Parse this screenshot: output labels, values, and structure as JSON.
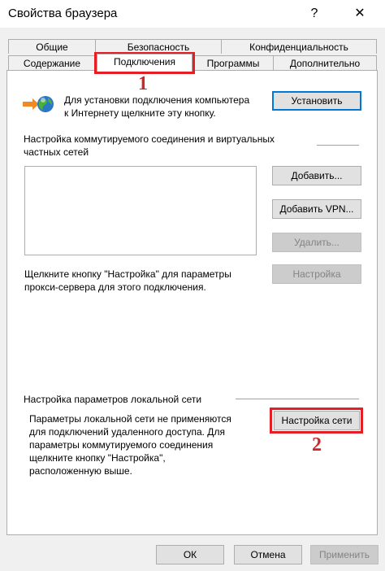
{
  "window": {
    "title": "Свойства браузера",
    "help_label": "?",
    "close_label": "✕"
  },
  "tabs": {
    "row1": [
      "Общие",
      "Безопасность",
      "Конфиденциальность"
    ],
    "row2": [
      "Содержание",
      "Подключения",
      "Программы",
      "Дополнительно"
    ],
    "active": "Подключения"
  },
  "setup": {
    "text_line1": "Для установки подключения компьютера",
    "text_line2": "к Интернету щелкните эту кнопку.",
    "button": "Установить"
  },
  "dialup": {
    "heading_line1": "Настройка коммутируемого соединения и виртуальных",
    "heading_line2": "частных сетей",
    "add_button": "Добавить...",
    "add_vpn_button": "Добавить VPN...",
    "remove_button": "Удалить...",
    "settings_button": "Настройка",
    "proxy_text_line1": "Щелкните кнопку \"Настройка\" для параметры",
    "proxy_text_line2": "прокси-сервера для этого подключения."
  },
  "lan": {
    "heading": "Настройка параметров локальной сети",
    "text_line1": "Параметры локальной сети не применяются",
    "text_line2": "для подключений удаленного доступа. Для",
    "text_line3": "параметры коммутируемого соединения",
    "text_line4": "щелкните кнопку \"Настройка\",",
    "text_line5": "расположенную выше.",
    "button": "Настройка сети"
  },
  "footer": {
    "ok": "ОК",
    "cancel": "Отмена",
    "apply": "Применить"
  },
  "annotations": {
    "marker1": "1",
    "marker2": "2"
  },
  "colors": {
    "highlight": "#e31e24",
    "focus_border": "#0078d7"
  }
}
